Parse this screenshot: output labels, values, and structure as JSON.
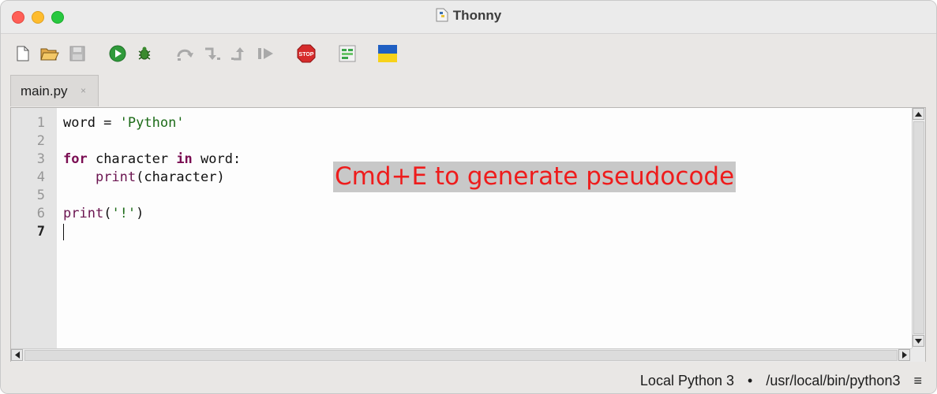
{
  "window": {
    "title": "Thonny",
    "controls": [
      "close",
      "minimize",
      "maximize"
    ]
  },
  "toolbar": {
    "buttons": [
      {
        "name": "new-file-icon",
        "enabled": true
      },
      {
        "name": "open-file-icon",
        "enabled": true
      },
      {
        "name": "save-file-icon",
        "enabled": false
      },
      {
        "name": "run-icon",
        "enabled": true
      },
      {
        "name": "debug-icon",
        "enabled": true
      },
      {
        "name": "step-over-icon",
        "enabled": false
      },
      {
        "name": "step-into-icon",
        "enabled": false
      },
      {
        "name": "step-out-icon",
        "enabled": false
      },
      {
        "name": "resume-icon",
        "enabled": false
      },
      {
        "name": "stop-icon",
        "enabled": true,
        "label": "STOP"
      },
      {
        "name": "zoom-icon",
        "enabled": true
      },
      {
        "name": "ukraine-flag-icon",
        "enabled": true
      }
    ]
  },
  "tabs": [
    {
      "label": "main.py",
      "close": "×",
      "active": true
    }
  ],
  "editor": {
    "line_numbers": [
      "1",
      "2",
      "3",
      "4",
      "5",
      "6",
      "7"
    ],
    "current_line": "7",
    "lines": [
      {
        "indent": "",
        "parts": [
          {
            "text": "word = ",
            "style": "plain"
          },
          {
            "text": "'Python'",
            "style": "string"
          }
        ]
      },
      {
        "indent": "",
        "parts": []
      },
      {
        "indent": "",
        "parts": [
          {
            "text": "for",
            "style": "keyword"
          },
          {
            "text": " character ",
            "style": "plain"
          },
          {
            "text": "in",
            "style": "keyword"
          },
          {
            "text": " word:",
            "style": "plain"
          }
        ]
      },
      {
        "indent": "    ",
        "parts": [
          {
            "text": "print",
            "style": "builtin"
          },
          {
            "text": "(character)",
            "style": "plain"
          }
        ]
      },
      {
        "indent": "",
        "parts": []
      },
      {
        "indent": "",
        "parts": [
          {
            "text": "print",
            "style": "builtin"
          },
          {
            "text": "(",
            "style": "plain"
          },
          {
            "text": "'!'",
            "style": "string"
          },
          {
            "text": ")",
            "style": "plain"
          }
        ]
      },
      {
        "indent": "",
        "parts": []
      }
    ],
    "overlay_hint": "Cmd+E to generate pseudocode"
  },
  "statusbar": {
    "interpreter": "Local Python 3",
    "separator": "•",
    "path": "/usr/local/bin/python3",
    "menu_icon": "≡"
  },
  "colors": {
    "keyword": "#7a0d52",
    "string": "#1c6b18",
    "overlay_text": "#ee1c1c",
    "overlay_bg": "#c8c8c8"
  }
}
